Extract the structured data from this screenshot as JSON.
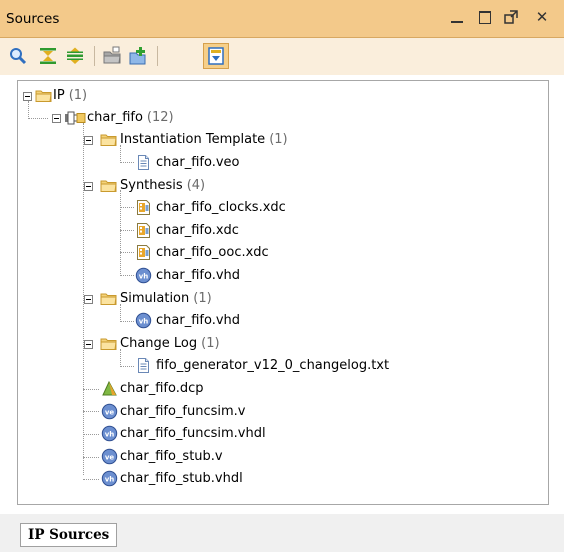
{
  "titlebar": {
    "title": "Sources"
  },
  "toolbar": {
    "icons": [
      "search-icon",
      "collapse-all-icon",
      "expand-all-icon",
      "open-folder-icon",
      "add-sources-icon",
      "hierarchy-update-icon"
    ]
  },
  "tree": {
    "ip": {
      "label": "IP",
      "count": "(1)"
    },
    "char_fifo": {
      "label": "char_fifo",
      "count": "(12)"
    },
    "instantiation_template": {
      "label": "Instantiation Template",
      "count": "(1)"
    },
    "veo": {
      "label": "char_fifo.veo"
    },
    "synthesis": {
      "label": "Synthesis",
      "count": "(4)"
    },
    "clocks_xdc": {
      "label": "char_fifo_clocks.xdc"
    },
    "xdc": {
      "label": "char_fifo.xdc"
    },
    "ooc_xdc": {
      "label": "char_fifo_ooc.xdc"
    },
    "synth_vhd": {
      "label": "char_fifo.vhd"
    },
    "simulation": {
      "label": "Simulation",
      "count": "(1)"
    },
    "sim_vhd": {
      "label": "char_fifo.vhd"
    },
    "change_log": {
      "label": "Change Log",
      "count": "(1)"
    },
    "changelog_txt": {
      "label": "fifo_generator_v12_0_changelog.txt"
    },
    "dcp": {
      "label": "char_fifo.dcp"
    },
    "funcsim_v": {
      "label": "char_fifo_funcsim.v"
    },
    "funcsim_vhdl": {
      "label": "char_fifo_funcsim.vhdl"
    },
    "stub_v": {
      "label": "char_fifo_stub.v"
    },
    "stub_vhdl": {
      "label": "char_fifo_stub.vhdl"
    }
  },
  "bottom_tab": {
    "label": "IP Sources"
  },
  "colors": {
    "titlebar_bg": "#f3c98a",
    "toolbar_bg": "#faeedc",
    "count_text": "#6b6b6b",
    "folder": "#f0c860"
  }
}
